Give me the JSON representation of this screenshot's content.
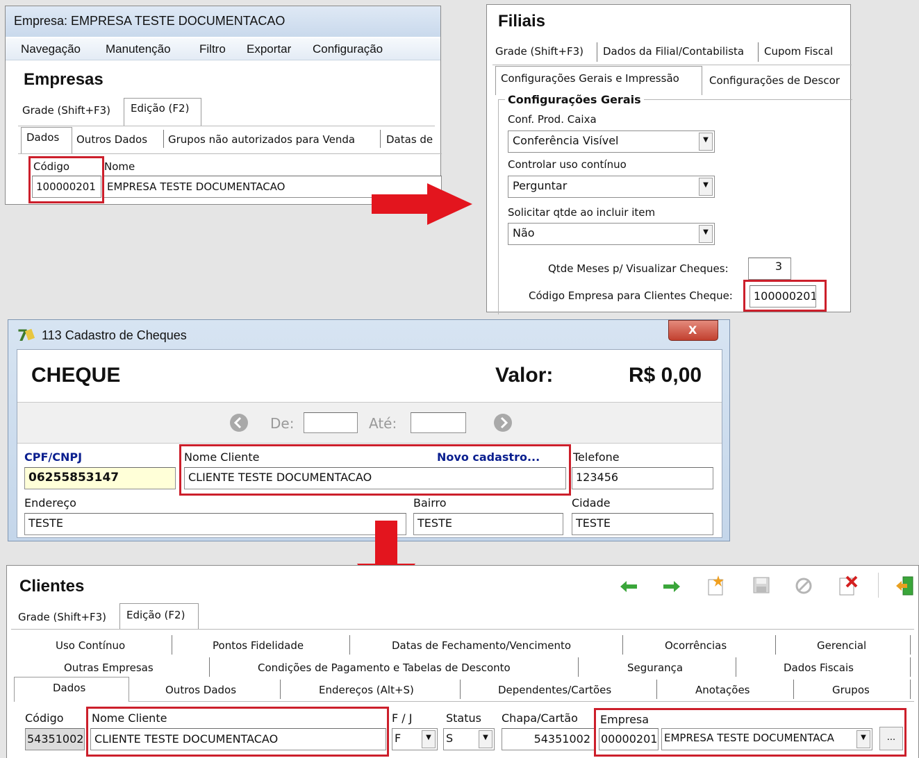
{
  "empresa": {
    "window_title": "Empresa: EMPRESA TESTE DOCUMENTACAO",
    "menu": [
      "Navegação",
      "Manutenção",
      "Filtro",
      "Exportar",
      "Configuração"
    ],
    "heading": "Empresas",
    "tabs": [
      "Grade (Shift+F3)",
      "Edição (F2)"
    ],
    "subtabs": [
      "Dados",
      "Outros Dados",
      "Grupos não autorizados para Venda",
      "Datas de"
    ],
    "codigo_label": "Código",
    "nome_label": "Nome",
    "codigo_value": "100000201",
    "nome_value": "EMPRESA TESTE DOCUMENTACAO"
  },
  "filiais": {
    "heading": "Filiais",
    "tabs": [
      "Grade (Shift+F3)",
      "Dados da Filial/Contabilista",
      "Cupom Fiscal"
    ],
    "subtabs": [
      "Configurações Gerais e Impressão",
      "Configurações de Descor"
    ],
    "group_title": "Configurações Gerais",
    "conf_prod_label": "Conf. Prod. Caixa",
    "conf_prod_value": "Conferência Visível",
    "controlar_label": "Controlar uso contínuo",
    "controlar_value": "Perguntar",
    "solicitar_label": "Solicitar qtde ao incluir item",
    "solicitar_value": "Não",
    "qtde_label": "Qtde Meses p/ Visualizar Cheques:",
    "qtde_value": "3",
    "codigo_emp_label": "Código Empresa para Clientes Cheque:",
    "codigo_emp_value": "100000201"
  },
  "cheques": {
    "window_title": "113 Cadastro de Cheques",
    "close_label": "X",
    "heading": "CHEQUE",
    "valor_label": "Valor:",
    "valor_value": "R$ 0,00",
    "de_label": "De:",
    "ate_label": "Até:",
    "cpf_label": "CPF/CNPJ",
    "cpf_value": "06255853147",
    "nome_label": "Nome Cliente",
    "novo_cadastro": "Novo cadastro...",
    "nome_value": "CLIENTE TESTE DOCUMENTACAO",
    "telefone_label": "Telefone",
    "telefone_value": "123456",
    "endereco_label": "Endereço",
    "endereco_value": "TESTE",
    "bairro_label": "Bairro",
    "bairro_value": "TESTE",
    "cidade_label": "Cidade",
    "cidade_value": "TESTE"
  },
  "clientes": {
    "heading": "Clientes",
    "tabs": [
      "Grade (Shift+F3)",
      "Edição (F2)"
    ],
    "tab_row1": [
      "Uso Contínuo",
      "Pontos Fidelidade",
      "Datas de Fechamento/Vencimento",
      "Ocorrências",
      "Gerencial"
    ],
    "tab_row2": [
      "Outras Empresas",
      "Condições de Pagamento e Tabelas de Desconto",
      "Segurança",
      "Dados Fiscais"
    ],
    "tab_row3": [
      "Dados",
      "Outros Dados",
      "Endereços (Alt+S)",
      "Dependentes/Cartões",
      "Anotações",
      "Grupos"
    ],
    "codigo_label": "Código",
    "codigo_value": "54351002",
    "nome_label": "Nome Cliente",
    "nome_value": "CLIENTE TESTE DOCUMENTACAO",
    "fj_label": "F / J",
    "fj_value": "F",
    "status_label": "Status",
    "status_value": "S",
    "chapa_label": "Chapa/Cartão",
    "chapa_value": "54351002",
    "empresa_label": "Empresa",
    "empresa_code": "00000201",
    "empresa_value": "EMPRESA TESTE DOCUMENTACA",
    "ellipsis": "..."
  },
  "colors": {
    "highlight": "#cc1f2b",
    "arrow": "#e3151e",
    "link_blue": "#0a1f8f"
  },
  "icons": [
    "back-arrow-icon",
    "forward-arrow-icon",
    "new-record-icon",
    "save-icon",
    "cancel-icon",
    "delete-icon",
    "exit-icon",
    "prev-circle-icon",
    "next-circle-icon",
    "app-logo-icon"
  ]
}
